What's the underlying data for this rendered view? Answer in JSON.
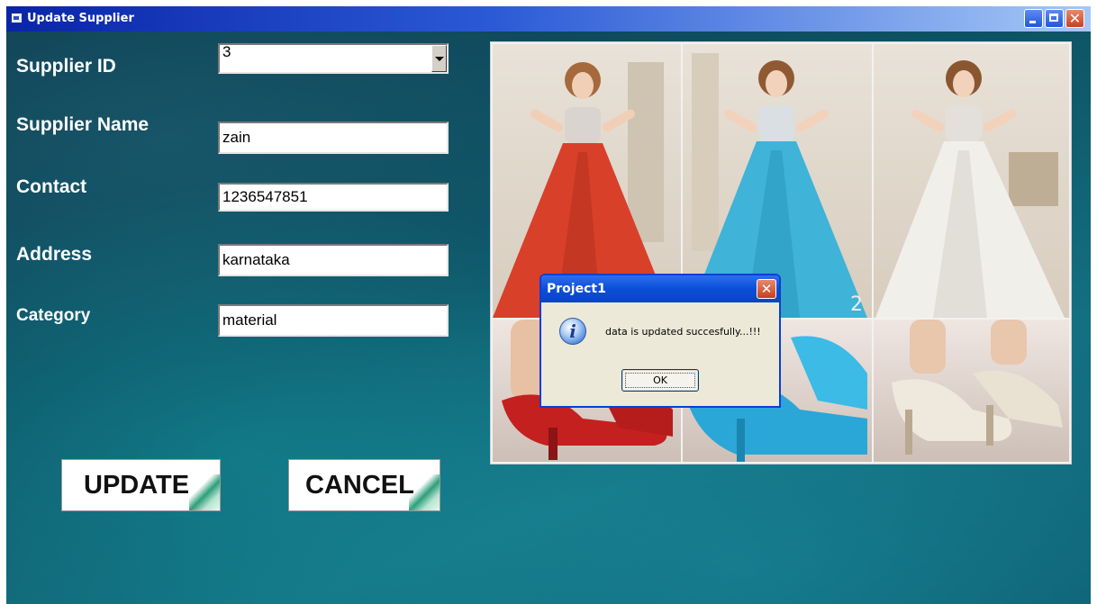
{
  "window": {
    "title": "Update Supplier",
    "controls": [
      "minimize-icon",
      "maximize-icon",
      "close-icon"
    ],
    "titlebar_color": "#0a24a8",
    "close_glyph": "✕"
  },
  "form": {
    "supplier_id_label": "Supplier ID",
    "supplier_id_value": "3",
    "supplier_name_label": "Supplier Name",
    "supplier_name_value": "zain",
    "contact_label": "Contact",
    "contact_value": "1236547851",
    "address_label": "Address",
    "address_value": "karnataka",
    "category_label": "Category",
    "category_value": "material"
  },
  "buttons": {
    "update": "UPDATE",
    "cancel": "CANCEL"
  },
  "collage": {
    "panels": [
      "red dress",
      "blue dress",
      "white dress",
      "red heels",
      "blue heels",
      "white heels"
    ],
    "panel_number": "2"
  },
  "dialog": {
    "title": "Project1",
    "icon": "info-icon",
    "icon_glyph": "i",
    "message": "data is updated succesfully...!!!",
    "ok_label": "OK",
    "close_glyph": "✕"
  }
}
